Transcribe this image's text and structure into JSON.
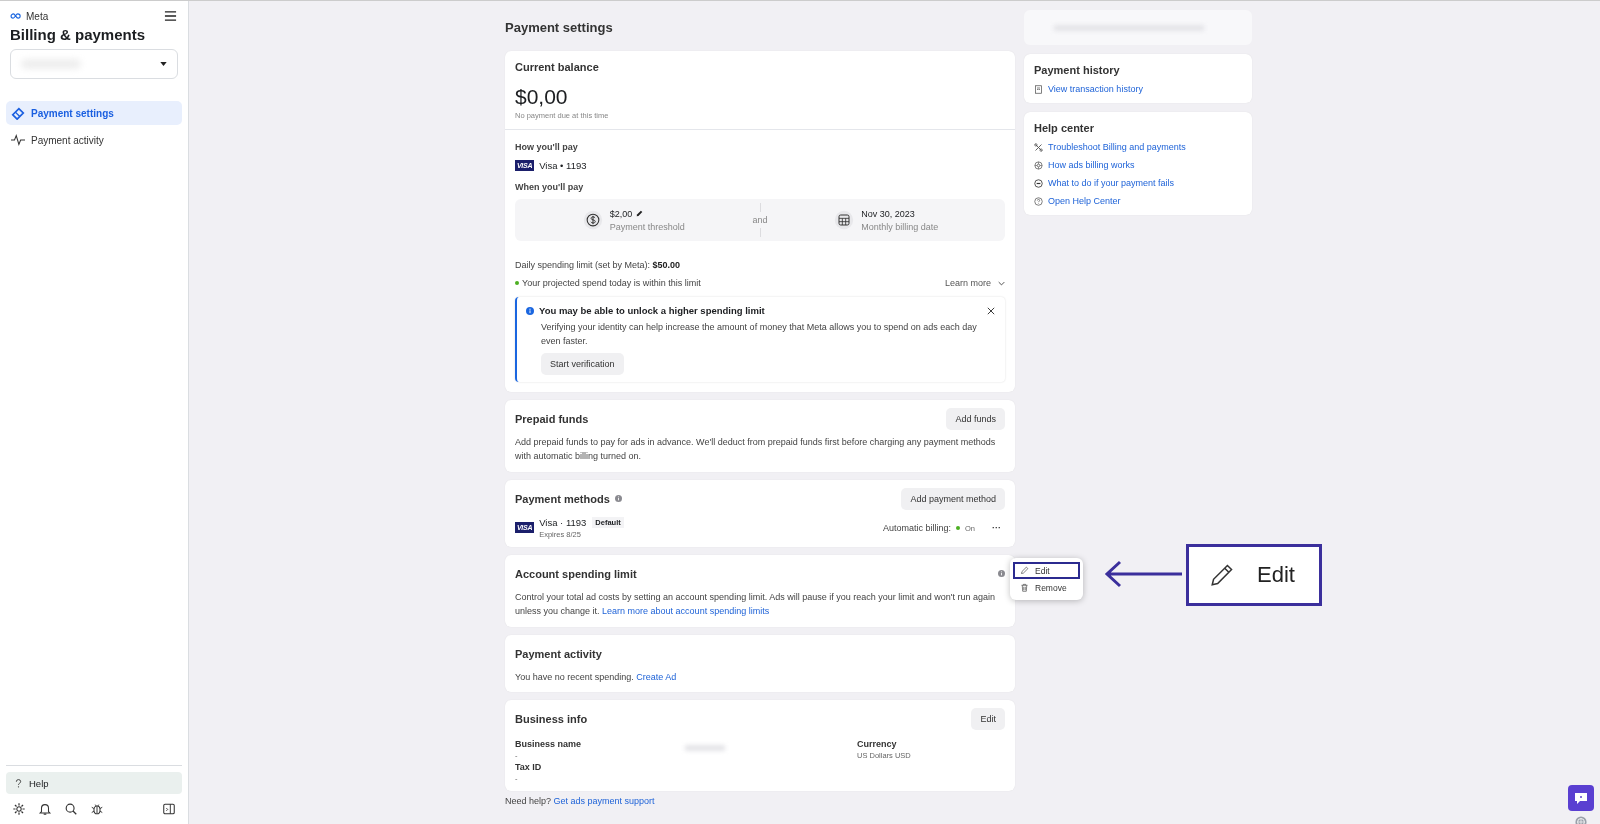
{
  "sidebar": {
    "brand": "Meta",
    "title": "Billing & payments",
    "nav": [
      {
        "label": "Payment settings",
        "selected": true
      },
      {
        "label": "Payment activity",
        "selected": false
      }
    ],
    "help": "Help"
  },
  "page_title": "Payment settings",
  "balance": {
    "title": "Current balance",
    "amount": "$0,00",
    "note": "No payment due at this time",
    "how_label": "How you'll pay",
    "card_brand": "VISA",
    "card": "Visa • 1193",
    "when_label": "When you'll pay",
    "threshold_value": "$2,00",
    "threshold_label": "Payment threshold",
    "joiner": "and",
    "date_value": "Nov 30, 2023",
    "date_label": "Monthly billing date",
    "daily_label": "Daily spending limit (set by Meta):",
    "daily_value": "$50.00",
    "projected": "Your projected spend today is within this limit",
    "within_limit": true,
    "learn_more": "Learn more",
    "notice": {
      "title": "You may be able to unlock a higher spending limit",
      "body": "Verifying your identity can help increase the amount of money that Meta allows you to spend on ads each day even faster.",
      "button": "Start verification"
    }
  },
  "prepaid": {
    "title": "Prepaid funds",
    "button": "Add funds",
    "body": "Add prepaid funds to pay for ads in advance. We'll deduct from prepaid funds first before charging any payment methods with automatic billing turned on."
  },
  "methods": {
    "title": "Payment methods",
    "button": "Add payment method",
    "card_brand": "VISA",
    "card": "Visa · 1193",
    "tag": "Default",
    "expires": "Expires 8/25",
    "billing_label": "Automatic billing:",
    "billing_value": "On",
    "billing_on": true,
    "more": "···"
  },
  "menu": [
    {
      "label": "Edit",
      "selected": true
    },
    {
      "label": "Remove",
      "selected": false
    }
  ],
  "limit": {
    "title": "Account spending limit",
    "body": "Control your total ad costs by setting an account spending limit. Ads will pause if you reach your limit and won't run again unless you change it.",
    "link": "Learn more about account spending limits"
  },
  "activity": {
    "title": "Payment activity",
    "body": "You have no recent spending.",
    "link": "Create Ad"
  },
  "business": {
    "title": "Business info",
    "button": "Edit",
    "name_label": "Business name",
    "name_value": "-",
    "tax_label": "Tax ID",
    "tax_value": "-",
    "currency_label": "Currency",
    "currency_value": "US Dollars USD"
  },
  "footer": {
    "text": "Need help?",
    "link": "Get ads payment support"
  },
  "history": {
    "title": "Payment history",
    "link": "View transaction history"
  },
  "help_center": {
    "title": "Help center",
    "links": [
      "Troubleshoot Billing and payments",
      "How ads billing works",
      "What to do if your payment fails",
      "Open Help Center"
    ]
  },
  "callout": {
    "label": "Edit"
  }
}
